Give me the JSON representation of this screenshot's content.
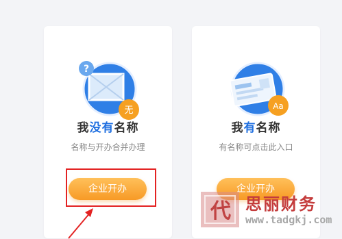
{
  "cards": [
    {
      "title_parts": [
        "我",
        "没有",
        "名称"
      ],
      "subtitle": "名称与开办合并办理",
      "button_label": "企业开办",
      "illustration_badge": "无",
      "illustration_mark": "?",
      "illustration_icon": "question-document-icon"
    },
    {
      "title_parts": [
        "我",
        "有",
        "名称"
      ],
      "subtitle": "有名称可点击此入口",
      "button_label": "企业开办",
      "illustration_badge": "Aa",
      "illustration_icon": "id-card-document-icon"
    }
  ],
  "watermark": {
    "brand_text": "思丽财务",
    "logo_char": "代",
    "url": "www.tadgkj.com"
  },
  "colors": {
    "accent_blue": "#1f6fe0",
    "button_orange": "#f79a26",
    "annotation_red": "#e32222",
    "watermark_red": "#c43c3c"
  }
}
